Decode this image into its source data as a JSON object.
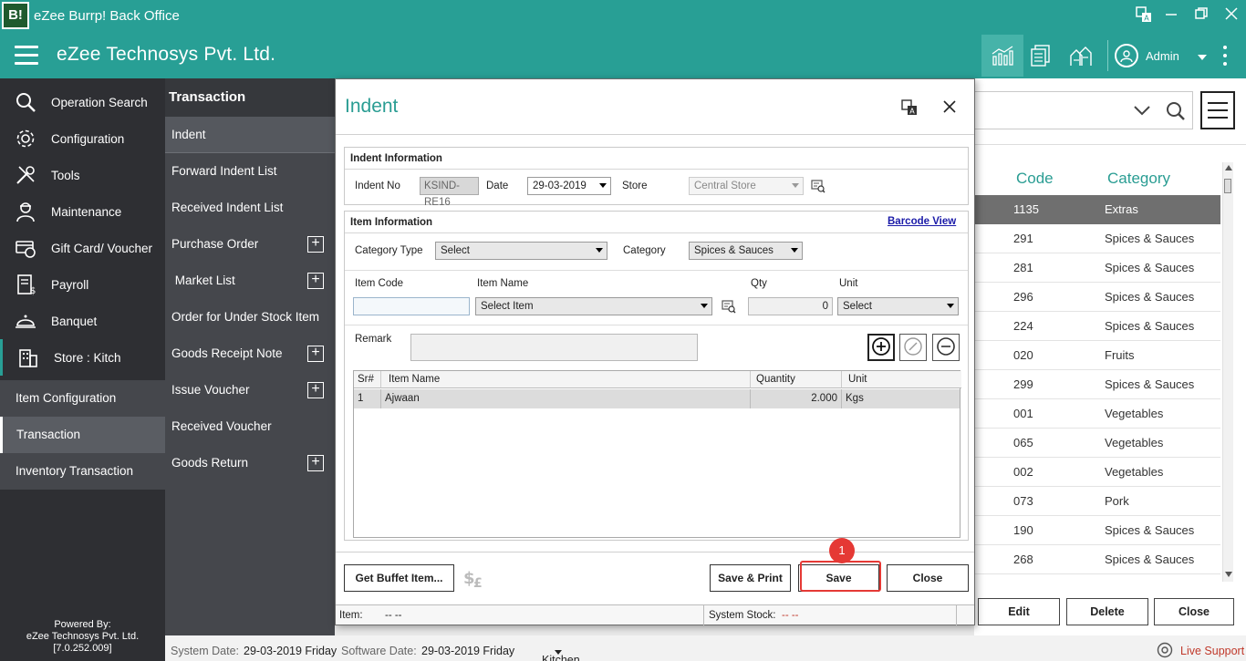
{
  "window": {
    "logo_text": "B!",
    "title": "eZee Burrp! Back Office"
  },
  "header": {
    "company": "eZee Technosys Pvt. Ltd.",
    "user": "Admin"
  },
  "sidebar": {
    "items": [
      {
        "label": "Operation Search",
        "icon": "search-icon"
      },
      {
        "label": "Configuration",
        "icon": "gear-icon"
      },
      {
        "label": "Tools",
        "icon": "tools-icon"
      },
      {
        "label": "Maintenance",
        "icon": "maintenance-icon"
      },
      {
        "label": "Gift Card/ Voucher",
        "icon": "gift-card-icon"
      },
      {
        "label": "Payroll",
        "icon": "payroll-icon"
      },
      {
        "label": "Banquet",
        "icon": "banquet-icon"
      },
      {
        "label": "Store : Kitch",
        "icon": "store-icon"
      }
    ],
    "subitems": [
      {
        "label": "Item Configuration"
      },
      {
        "label": "Transaction"
      },
      {
        "label": "Inventory Transaction"
      }
    ],
    "powered_by": [
      "Powered By:",
      "eZee Technosys Pvt. Ltd.",
      "[7.0.252.009]"
    ]
  },
  "submenu": {
    "title": "Transaction",
    "items": [
      {
        "label": "Indent",
        "expandable": false
      },
      {
        "label": "Forward Indent List",
        "expandable": false
      },
      {
        "label": "Received Indent List",
        "expandable": false
      },
      {
        "label": "Purchase Order",
        "expandable": true
      },
      {
        "label": " Market List",
        "expandable": true
      },
      {
        "label": "Order for Under Stock Item",
        "expandable": false
      },
      {
        "label": "Goods Receipt Note",
        "expandable": true
      },
      {
        "label": "Issue Voucher",
        "expandable": true
      },
      {
        "label": "Received Voucher",
        "expandable": false
      },
      {
        "label": "Goods Return",
        "expandable": true
      }
    ]
  },
  "background_list": {
    "columns": [
      "Code",
      "Category"
    ],
    "rows": [
      {
        "code": "1135",
        "category": "Extras"
      },
      {
        "code": "291",
        "category": "Spices & Sauces"
      },
      {
        "code": "281",
        "category": "Spices & Sauces"
      },
      {
        "code": "296",
        "category": "Spices & Sauces"
      },
      {
        "code": "224",
        "category": "Spices & Sauces"
      },
      {
        "code": "020",
        "category": "Fruits"
      },
      {
        "code": "299",
        "category": "Spices & Sauces"
      },
      {
        "code": "001",
        "category": "Vegetables"
      },
      {
        "code": "065",
        "category": "Vegetables"
      },
      {
        "code": "002",
        "category": "Vegetables"
      },
      {
        "code": "073",
        "category": "Pork"
      },
      {
        "code": "190",
        "category": "Spices & Sauces"
      },
      {
        "code": "268",
        "category": "Spices & Sauces"
      }
    ],
    "buttons": {
      "edit": "Edit",
      "delete": "Delete",
      "close": "Close"
    }
  },
  "statusbar": {
    "system_date_label": "System Date:",
    "system_date": "29-03-2019 Friday",
    "software_date_label": "Software Date:",
    "software_date": "29-03-2019 Friday",
    "store": "Kitchen Store",
    "live_support": "Live Support"
  },
  "indent": {
    "title": "Indent",
    "indent_info": {
      "heading": "Indent Information",
      "indent_no_label": "Indent No",
      "indent_no": "KSIND-RE16",
      "date_label": "Date",
      "date": "29-03-2019",
      "store_label": "Store",
      "store": "Central Store"
    },
    "item_info": {
      "heading": "Item Information",
      "barcode_link": "Barcode View",
      "category_type_label": "Category Type",
      "category_type": "Select",
      "category_label": "Category",
      "category": "Spices & Sauces",
      "item_code_label": "Item Code",
      "item_code": "",
      "item_name_label": "Item Name",
      "item_name": "Select Item",
      "qty_label": "Qty",
      "qty": "0",
      "unit_label": "Unit",
      "unit": "Select",
      "remark_label": "Remark",
      "remark": ""
    },
    "grid": {
      "columns": [
        "Sr#",
        "Item Name",
        "Quantity",
        "Unit"
      ],
      "rows": [
        {
          "sr": "1",
          "item": "Ajwaan",
          "qty": "2.000",
          "unit": "Kgs"
        }
      ]
    },
    "buttons": {
      "buffet": "Get Buffet Item...",
      "save_print": "Save & Print",
      "save": "Save",
      "close": "Close"
    },
    "status": {
      "item_label": "Item:",
      "item_value": "-- --",
      "stock_label": "System Stock:",
      "stock_value": "-- --"
    },
    "step_badge": "1"
  }
}
